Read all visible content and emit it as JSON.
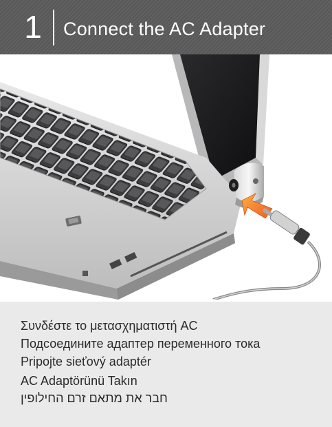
{
  "header": {
    "step_number": "1",
    "title": "Connect the AC Adapter"
  },
  "illustration": {
    "subject": "laptop-with-ac-adapter-connector"
  },
  "caption": {
    "lines": [
      {
        "lang": "el",
        "text": "Συνδέστε το μετασχηματιστή AC"
      },
      {
        "lang": "ru",
        "text": "Подсоедините адаптер переменного тока"
      },
      {
        "lang": "sk",
        "text": "Pripojte sieťový adaptér"
      },
      {
        "lang": "tr",
        "text": "AC Adaptörünü Takın"
      },
      {
        "lang": "he",
        "text": "חבר את מתאם זרם החילופין"
      }
    ]
  },
  "colors": {
    "header_bg": "#5b5b5b",
    "header_text": "#ffffff",
    "caption_bg": "#eaeaea",
    "caption_text": "#2a2a2a",
    "arrow": "#f7941d"
  }
}
